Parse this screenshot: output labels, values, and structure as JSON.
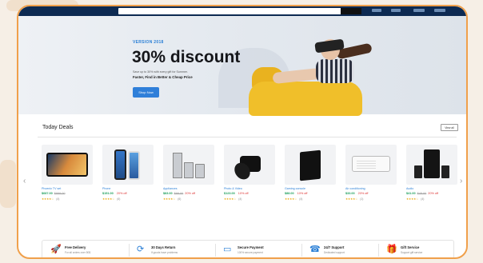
{
  "topbar": {
    "logo": ""
  },
  "hero": {
    "badge": "VERSION 2018",
    "headline": "30% discount",
    "line1": "Save up to 30% with every gift for Summer.",
    "line2": "Faster, Find in Better & Cheap Price",
    "button": "Shop Now"
  },
  "deals": {
    "title": "Today Deals",
    "view_all": "View all",
    "products": [
      {
        "name": "Phoenix TV set",
        "price": "$687.00",
        "old": "$899.00",
        "off": "",
        "stars": "★★★★☆",
        "count": "(4)"
      },
      {
        "name": "Phone",
        "price": "$151.00",
        "old": "",
        "off": "20% off",
        "stars": "★★★★☆",
        "count": "(6)"
      },
      {
        "name": "Appliances",
        "price": "$83.00",
        "old": "$99.00",
        "off": "20% off",
        "stars": "★★★★☆",
        "count": "(6)"
      },
      {
        "name": "Photo & Video",
        "price": "$123.00",
        "old": "",
        "off": "10% off",
        "stars": "★★★★☆",
        "count": "(4)"
      },
      {
        "name": "Gaming console",
        "price": "$88.00",
        "old": "",
        "off": "10% off",
        "stars": "★★★★☆",
        "count": "(4)"
      },
      {
        "name": "Air conditioning",
        "price": "$33.00",
        "old": "",
        "off": "20% off",
        "stars": "★★★★☆",
        "count": "(1)"
      },
      {
        "name": "Audio",
        "price": "$41.00",
        "old": "$48.00",
        "off": "20% off",
        "stars": "★★★★☆",
        "count": "(4)"
      }
    ]
  },
  "services": [
    {
      "icon": "rocket-icon",
      "glyph": "🚀",
      "title": "Free Delivery",
      "sub": "For all orders over 50$"
    },
    {
      "icon": "return-icon",
      "glyph": "⟳",
      "title": "30 Days Return",
      "sub": "If goods have problems"
    },
    {
      "icon": "card-icon",
      "glyph": "▭",
      "title": "Secure Payment",
      "sub": "100% secure payment"
    },
    {
      "icon": "support-icon",
      "glyph": "☎",
      "title": "24/7 Support",
      "sub": "Dedicated support"
    },
    {
      "icon": "gift-icon",
      "glyph": "🎁",
      "title": "Gift Service",
      "sub": "Support gift service"
    }
  ],
  "colors": {
    "frame": "#f0a04b",
    "accent": "#2f7fd9",
    "price": "#1a9e5a",
    "discount": "#dd3333"
  }
}
